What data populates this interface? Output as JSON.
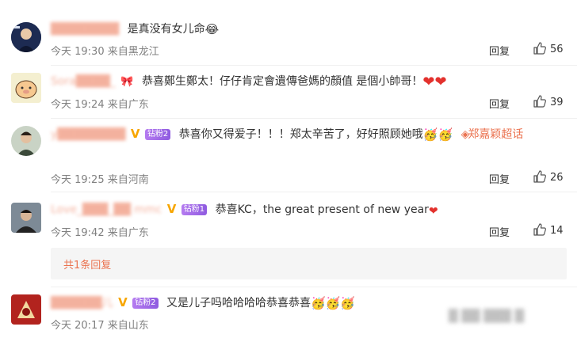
{
  "comments": [
    {
      "username": "████████",
      "text": "是真没有女儿命",
      "emoji": "😂",
      "time": "今天 19:30 来自黑龙江",
      "reply": "回复",
      "likes": "56"
    },
    {
      "username": "Sora████_",
      "text": "恭喜鄭生鄭太！仔仔肯定會遺傳爸媽的顏值 是個小帥哥！",
      "emoji": "❤❤",
      "time": "今天 19:24 来自广东",
      "reply": "回复",
      "likes": "39"
    },
    {
      "username": "y████████",
      "badge": "钻粉2",
      "text": "恭喜你又得爱子！！！郑太辛苦了，好好照顾她哦",
      "emoji": "🥳🥳",
      "mention": "郑嘉颖超话",
      "time": "今天 19:25 来自河南",
      "reply": "回复",
      "likes": "26"
    },
    {
      "username": "Love_███_██ mmc",
      "badge": "钻粉1",
      "text": "恭喜KC，the great present of new year",
      "emoji": "❤",
      "time": "今天 19:42 来自广东",
      "reply": "回复",
      "likes": "14"
    },
    {
      "username": "██████儿",
      "badge": "钻粉2",
      "text": "又是儿子吗哈哈哈哈恭喜恭喜",
      "emoji": "🥳🥳🥳",
      "time": "今天 20:17 来自山东"
    }
  ],
  "reply_summary": "共1条回复",
  "blurred_footer": "█ ██ ███ █"
}
